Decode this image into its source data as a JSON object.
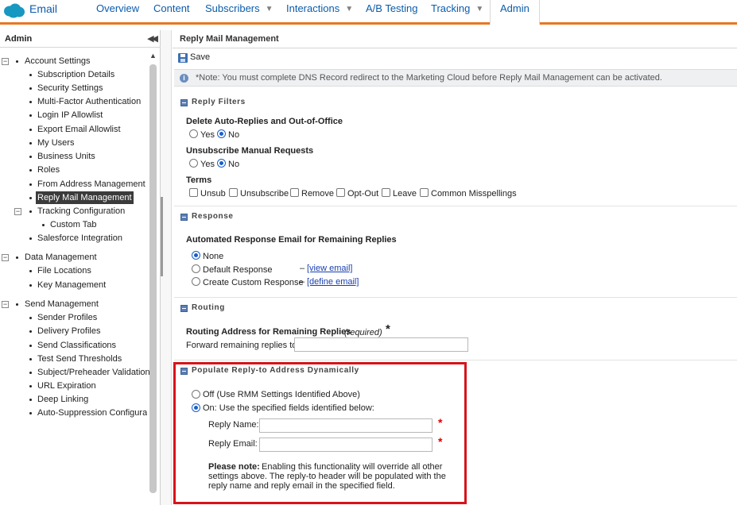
{
  "app": {
    "name": "Email"
  },
  "nav": {
    "tabs": [
      {
        "label": "Overview"
      },
      {
        "label": "Content"
      },
      {
        "label": "Subscribers"
      },
      {
        "label": "Interactions"
      },
      {
        "label": "A/B Testing"
      },
      {
        "label": "Tracking"
      },
      {
        "label": "Admin"
      }
    ],
    "accent": "#e87722",
    "active": "Admin"
  },
  "sidebar": {
    "title": "Admin",
    "groups": [
      {
        "label": "Account Settings",
        "items": [
          "Subscription Details",
          "Security Settings",
          "Multi-Factor Authentication",
          "Login IP Allowlist",
          "Export Email Allowlist",
          "My Users",
          "Business Units",
          "Roles",
          "From Address Management",
          "Reply Mail Management",
          "Tracking Configuration",
          "Custom Tab",
          "Salesforce Integration"
        ]
      },
      {
        "label": "Data Management",
        "items": [
          "File Locations",
          "Key Management"
        ]
      },
      {
        "label": "Send Management",
        "items": [
          "Sender Profiles",
          "Delivery Profiles",
          "Send Classifications",
          "Test Send Thresholds",
          "Subject/Preheader Validation",
          "URL Expiration",
          "Deep Linking",
          "Auto-Suppression Configuratio"
        ]
      }
    ],
    "selected": "Reply Mail Management"
  },
  "main": {
    "title": "Reply Mail Management",
    "save_label": "Save",
    "note": "*Note: You must complete DNS Record redirect to the Marketing Cloud before Reply Mail Management can be activated.",
    "reply_filters": {
      "heading": "Reply Filters",
      "auto_replies_label": "Delete Auto-Replies and Out-of-Office",
      "unsub_label": "Unsubscribe Manual Requests",
      "yes": "Yes",
      "no": "No",
      "auto_replies_value": "No",
      "unsub_value": "No",
      "terms_label": "Terms",
      "terms": [
        "Unsub",
        "Unsubscribe",
        "Remove",
        "Opt-Out",
        "Leave",
        "Common Misspellings"
      ]
    },
    "response": {
      "heading": "Response",
      "label": "Automated Response Email for Remaining Replies",
      "options": [
        "None",
        "Default Response",
        "Create Custom Response"
      ],
      "selected": "None",
      "dash": "–",
      "view_link": "[view email]",
      "define_link": "[define email]"
    },
    "routing": {
      "heading": "Routing",
      "label": "Routing Address for Remaining Replies",
      "required": "(required)",
      "star": "*",
      "forward_label": "Forward remaining replies to:",
      "forward_value": ""
    },
    "populate": {
      "heading": "Populate Reply-to Address Dynamically",
      "off_label": "Off (Use RMM Settings Identified Above)",
      "on_label": "On: Use the specified fields identified below:",
      "selected": "On",
      "reply_name_label": "Reply Name:",
      "reply_name_value": "",
      "reply_email_label": "Reply Email:",
      "reply_email_value": "",
      "star": "*",
      "please_note_bold": "Please note:",
      "please_note_line1": "Enabling this functionality will override all other",
      "please_note_line2": "settings above. The reply-to header will be populated with the",
      "please_note_line3": "reply name and reply email in the specified field.",
      "highlight_color": "#d6131b"
    }
  }
}
